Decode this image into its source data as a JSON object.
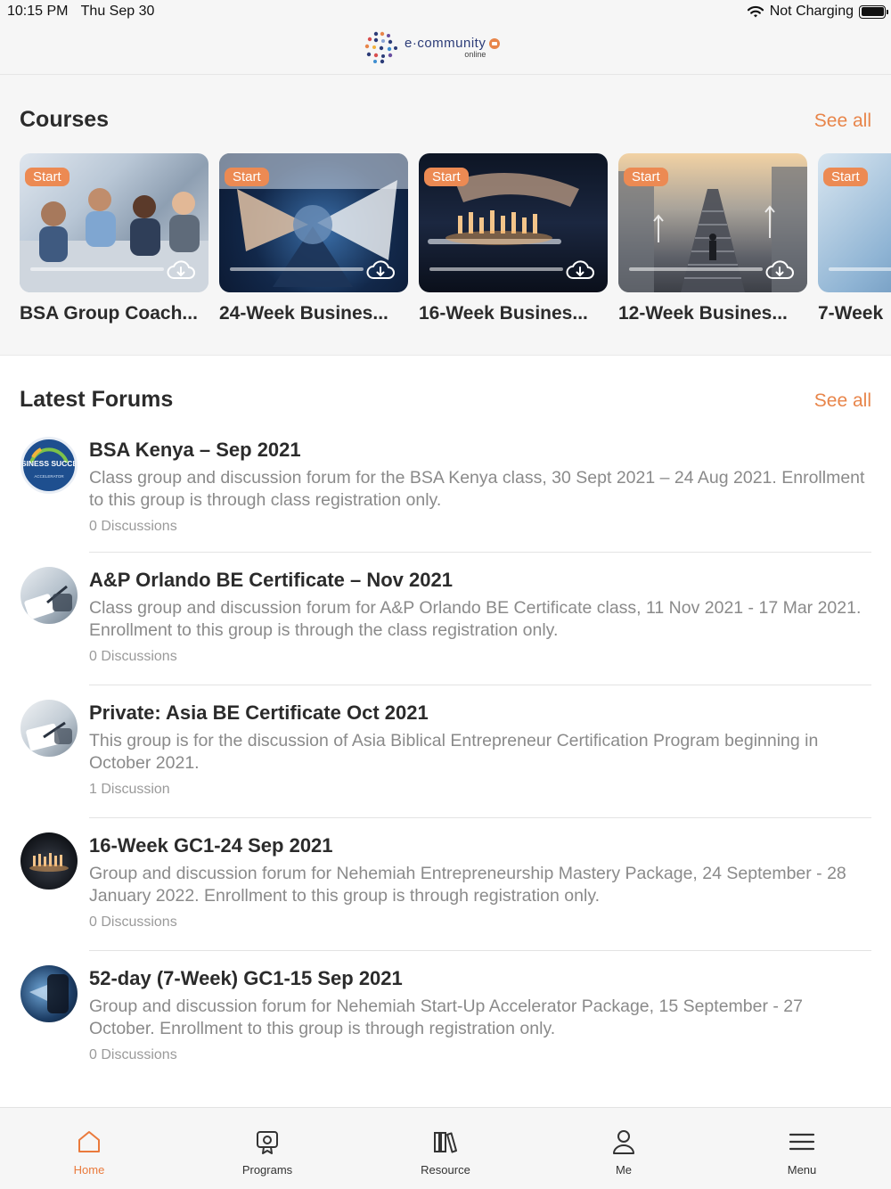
{
  "status_bar": {
    "time": "10:15 PM",
    "date": "Thu Sep 30",
    "battery_text": "Not Charging"
  },
  "header": {
    "logo_main": "e·community",
    "logo_sub": "online"
  },
  "courses": {
    "title": "Courses",
    "see_all": "See all",
    "items": [
      {
        "title": "BSA Group Coach...",
        "badge": "Start",
        "progress": 0
      },
      {
        "title": "24-Week Busines...",
        "badge": "Start",
        "progress": 0
      },
      {
        "title": "16-Week Busines...",
        "badge": "Start",
        "progress": 0
      },
      {
        "title": "12-Week Busines...",
        "badge": "Start",
        "progress": 0
      },
      {
        "title": "7-Week",
        "badge": "Start",
        "progress": 0
      }
    ]
  },
  "forums": {
    "title": "Latest Forums",
    "see_all": "See all",
    "items": [
      {
        "title": "BSA Kenya – Sep 2021",
        "description": "Class group and discussion forum for the BSA Kenya class, 30 Sept 2021 – 24 Aug 2021. Enrollment to this group is through class registration only.",
        "count": "0 Discussions",
        "avatar_text": "BUSINESS SUCCESS",
        "avatar_sub": "ACCELERATOR"
      },
      {
        "title": "A&P Orlando BE Certificate – Nov 2021",
        "description": "Class group and discussion forum for A&P Orlando BE Certificate class, 11 Nov 2021 - 17 Mar 2021. Enrollment to this group is through the class registration only.",
        "count": "0 Discussions"
      },
      {
        "title": "Private: Asia BE Certificate Oct 2021",
        "description": "This group is for the discussion of Asia Biblical Entrepreneur Certification Program beginning in October 2021.",
        "count": "1 Discussion"
      },
      {
        "title": "16-Week GC1-24 Sep 2021",
        "description": "Group and discussion forum for Nehemiah Entrepreneurship Mastery Package, 24 September - 28 January 2022. Enrollment to this group is through registration only.",
        "count": "0 Discussions"
      },
      {
        "title": "52-day (7-Week) GC1-15 Sep 2021",
        "description": "Group and discussion forum for Nehemiah Start-Up Accelerator Package, 15 September - 27 October. Enrollment to this group is through registration only.",
        "count": "0 Discussions"
      }
    ]
  },
  "tabbar": {
    "items": [
      {
        "label": "Home",
        "icon": "home-icon",
        "active": true
      },
      {
        "label": "Programs",
        "icon": "programs-icon",
        "active": false
      },
      {
        "label": "Resource",
        "icon": "books-icon",
        "active": false
      },
      {
        "label": "Me",
        "icon": "person-icon",
        "active": false
      },
      {
        "label": "Menu",
        "icon": "hamburger-icon",
        "active": false
      }
    ]
  },
  "colors": {
    "accent": "#E8854A",
    "badge": "#EC8A53",
    "text": "#2B2B2B",
    "muted": "#8A8A8A"
  }
}
